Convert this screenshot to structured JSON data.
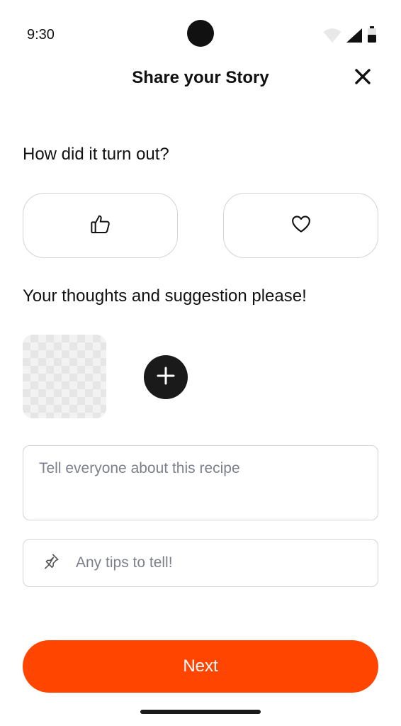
{
  "status_bar": {
    "time": "9:30"
  },
  "header": {
    "title": "Share your Story",
    "close_icon": "close-icon"
  },
  "question": {
    "label": "How did it turn out?",
    "options": [
      {
        "icon": "thumbs-up-icon"
      },
      {
        "icon": "heart-icon"
      }
    ]
  },
  "feedback": {
    "label": "Your thoughts and suggestion please!",
    "story_placeholder": "Tell everyone about this recipe",
    "tips_placeholder": "Any tips to tell!",
    "tips_icon": "pin-icon"
  },
  "actions": {
    "next_label": "Next"
  },
  "colors": {
    "accent": "#ff4500",
    "dark": "#1a1a1a",
    "border": "#d4d4d4",
    "placeholder": "#7b808c"
  }
}
